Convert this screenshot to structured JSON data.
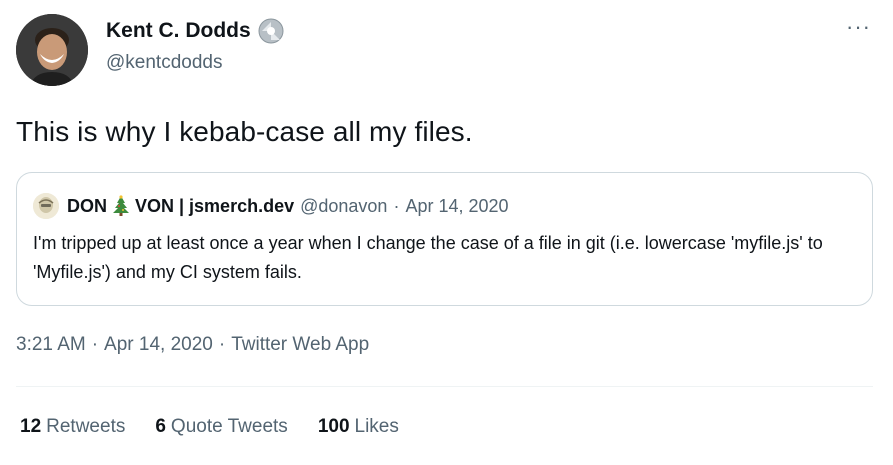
{
  "author": {
    "name": "Kent C. Dodds",
    "handle": "@kentcdodds"
  },
  "tweet": {
    "text": "This is why I kebab-case all my files."
  },
  "quote": {
    "name_part1": "DON",
    "name_part2": "VON | jsmerch.dev",
    "handle": "@donavon",
    "separator": "·",
    "date": "Apr 14, 2020",
    "text": "I'm tripped up at least once a year when I change the case of a file in git (i.e. lowercase 'myfile.js' to 'Myfile.js') and my CI system fails."
  },
  "meta": {
    "time": "3:21 AM",
    "separator": "·",
    "date": "Apr 14, 2020",
    "source": "Twitter Web App"
  },
  "stats": [
    {
      "count": "12",
      "label": "Retweets"
    },
    {
      "count": "6",
      "label": "Quote Tweets"
    },
    {
      "count": "100",
      "label": "Likes"
    }
  ],
  "more_label": "···",
  "icons": {
    "verified": "verified-badge-icon",
    "tree": "christmas-tree-icon",
    "more": "more-icon"
  }
}
